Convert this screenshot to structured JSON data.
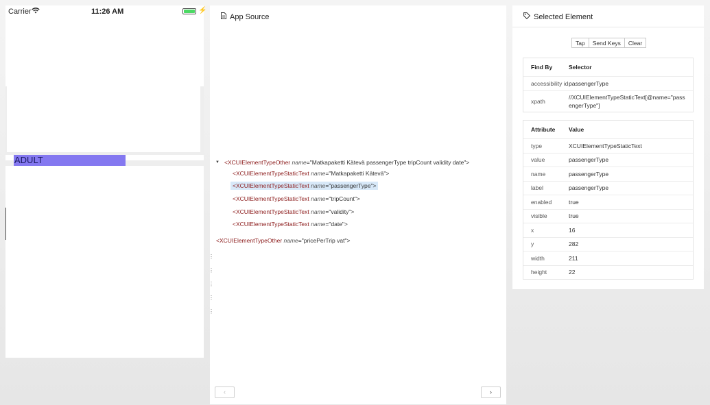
{
  "device": {
    "carrier": "Carrier",
    "time": "11:26 AM",
    "selected_text": "ADULT"
  },
  "source": {
    "title": "App Source",
    "nodes": [
      {
        "tag": "<XCUIElementTypeOther",
        "attr": "name",
        "value": "\"Matkapaketti Kätevä passengerType tripCount validity date\">"
      },
      {
        "tag": "<XCUIElementTypeStaticText",
        "attr": "name",
        "value": "\"Matkapaketti Kätevä\">"
      },
      {
        "tag": "<XCUIElementTypeStaticText",
        "attr": "name",
        "value": "\"passengerType\">"
      },
      {
        "tag": "<XCUIElementTypeStaticText",
        "attr": "name",
        "value": "\"tripCount\">"
      },
      {
        "tag": "<XCUIElementTypeStaticText",
        "attr": "name",
        "value": "\"validity\">"
      },
      {
        "tag": "<XCUIElementTypeStaticText",
        "attr": "name",
        "value": "\"date\">"
      },
      {
        "tag": "<XCUIElementTypeOther",
        "attr": "name",
        "value": "\"pricePerTrip vat\">"
      }
    ],
    "prev_label": "‹",
    "next_label": "›"
  },
  "inspector": {
    "title": "Selected Element",
    "actions": [
      "Tap",
      "Send Keys",
      "Clear"
    ],
    "find_by": {
      "header": [
        "Find By",
        "Selector"
      ],
      "rows": [
        [
          "accessibility id",
          "passengerType"
        ],
        [
          "xpath",
          "//XCUIElementTypeStaticText[@name=\"passengerType\"]"
        ]
      ]
    },
    "attributes": {
      "header": [
        "Attribute",
        "Value"
      ],
      "rows": [
        [
          "type",
          "XCUIElementTypeStaticText"
        ],
        [
          "value",
          "passengerType"
        ],
        [
          "name",
          "passengerType"
        ],
        [
          "label",
          "passengerType"
        ],
        [
          "enabled",
          "true"
        ],
        [
          "visible",
          "true"
        ],
        [
          "x",
          "16"
        ],
        [
          "y",
          "282"
        ],
        [
          "width",
          "211"
        ],
        [
          "height",
          "22"
        ]
      ]
    }
  }
}
